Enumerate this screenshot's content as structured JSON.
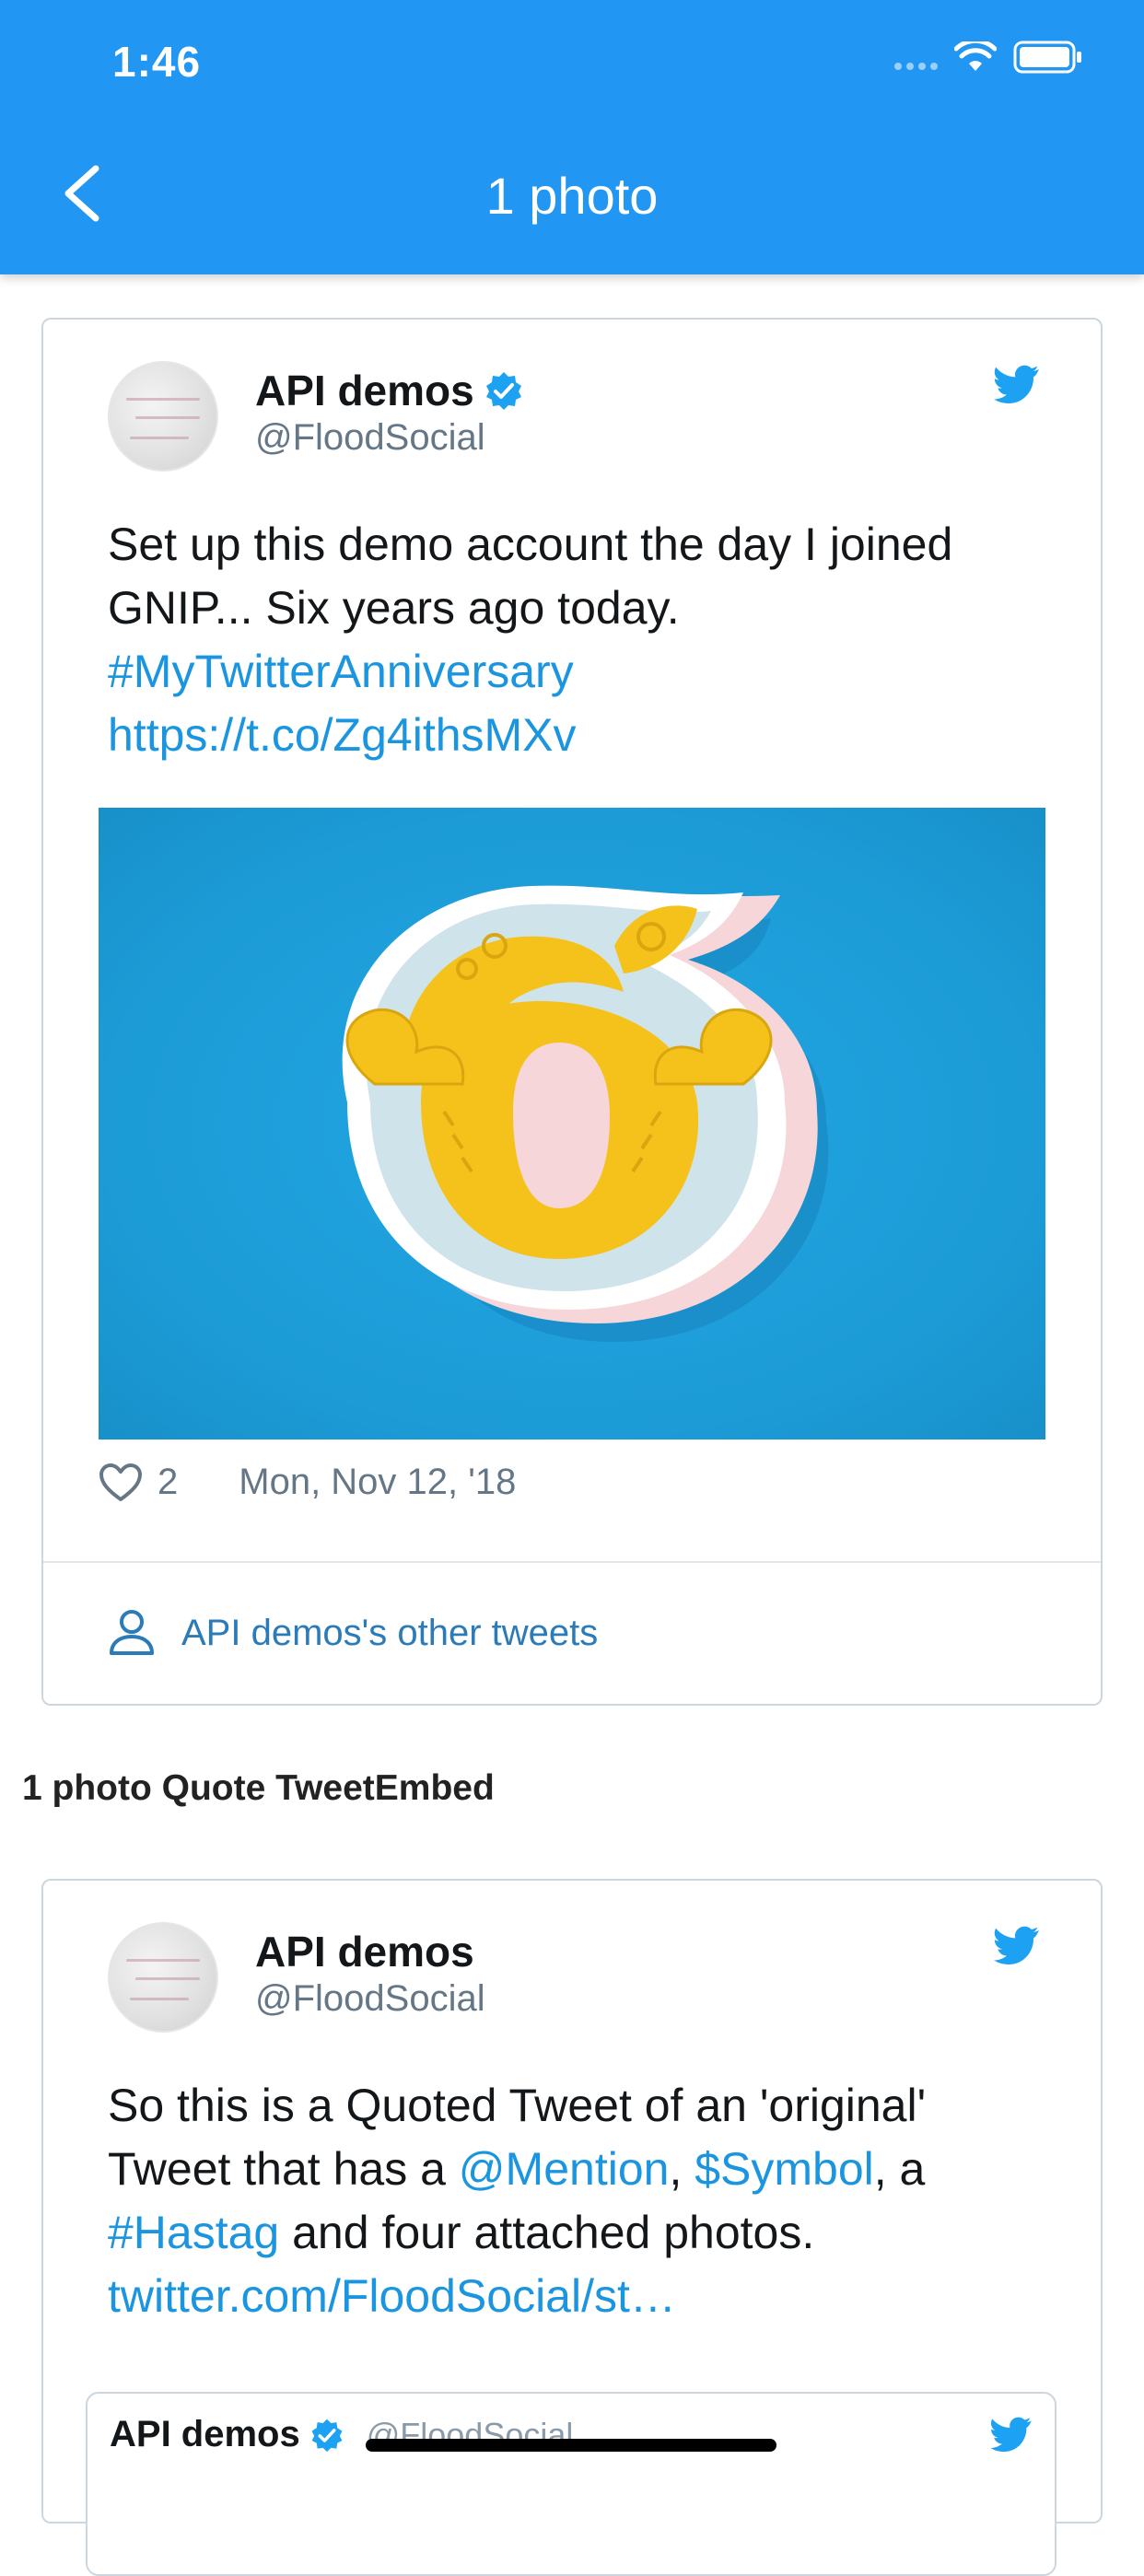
{
  "status_bar": {
    "time": "1:46"
  },
  "app_bar": {
    "title": "1 photo",
    "back_icon": "chevron-left-icon"
  },
  "colors": {
    "app_bar": "#2196f3",
    "link": "#1b95e0",
    "border": "#ccd6dd",
    "muted": "#657786"
  },
  "tweet1": {
    "author_name": "API demos",
    "handle": "@FloodSocial",
    "text_plain": "Set up this demo account the day I joined GNIP... Six years ago today.",
    "hashtag": "#MyTwitterAnniversary",
    "url": "https://t.co/Zg4ithsMXv",
    "likes": "2",
    "date": "Mon, Nov 12, '18",
    "other_tweets": "API demos's other tweets"
  },
  "section_label": "1 photo Quote TweetEmbed",
  "tweet2": {
    "author_name": "API demos",
    "handle": "@FloodSocial",
    "text_1": "So this is a Quoted Tweet of an 'original' Tweet that has a ",
    "mention": "@Mention",
    "text_2": ",  ",
    "symbol": "$Symbol",
    "text_3": ", a ",
    "hashtag": "#Hastag",
    "text_4": " and four attached photos.",
    "url": "twitter.com/FloodSocial/st…",
    "quoted": {
      "author_name": "API demos",
      "handle": "@FloodSocial"
    }
  }
}
